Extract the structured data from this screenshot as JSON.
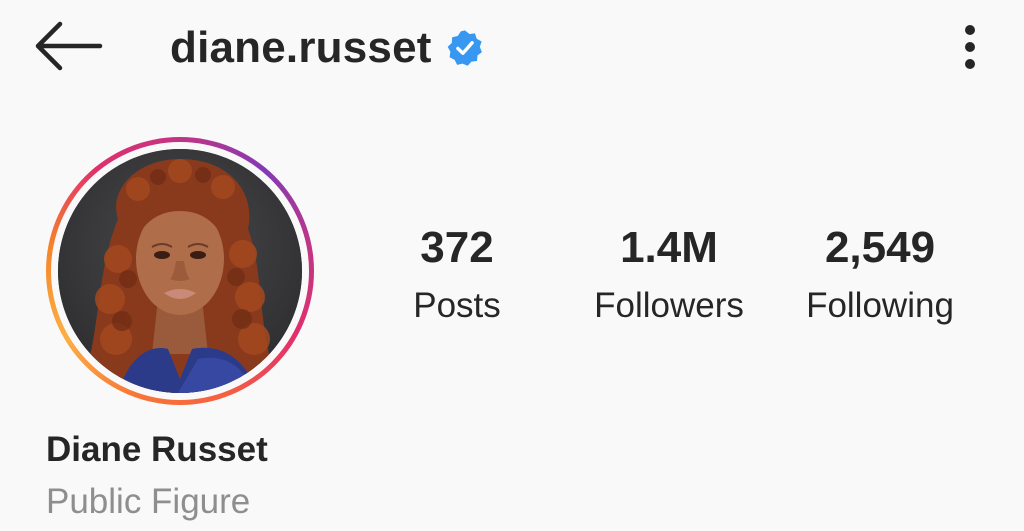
{
  "header": {
    "back_icon": "arrow-left-icon",
    "username": "diane.russet",
    "verified_icon": "verified-badge-icon",
    "more_icon": "more-vertical-icon"
  },
  "profile": {
    "avatar": "profile-photo",
    "full_name": "Diane Russet",
    "category": "Public Figure"
  },
  "stats": [
    {
      "value": "372",
      "label": "Posts"
    },
    {
      "value": "1.4M",
      "label": "Followers"
    },
    {
      "value": "2,549",
      "label": "Following"
    }
  ],
  "colors": {
    "background": "#f9f9f9",
    "text": "#262626",
    "secondary_text": "#8e8e8e",
    "verified_blue": "#3897f0",
    "story_ring": [
      "#f58529",
      "#fcaf45",
      "#e1306c",
      "#c13584",
      "#833ab4"
    ]
  }
}
